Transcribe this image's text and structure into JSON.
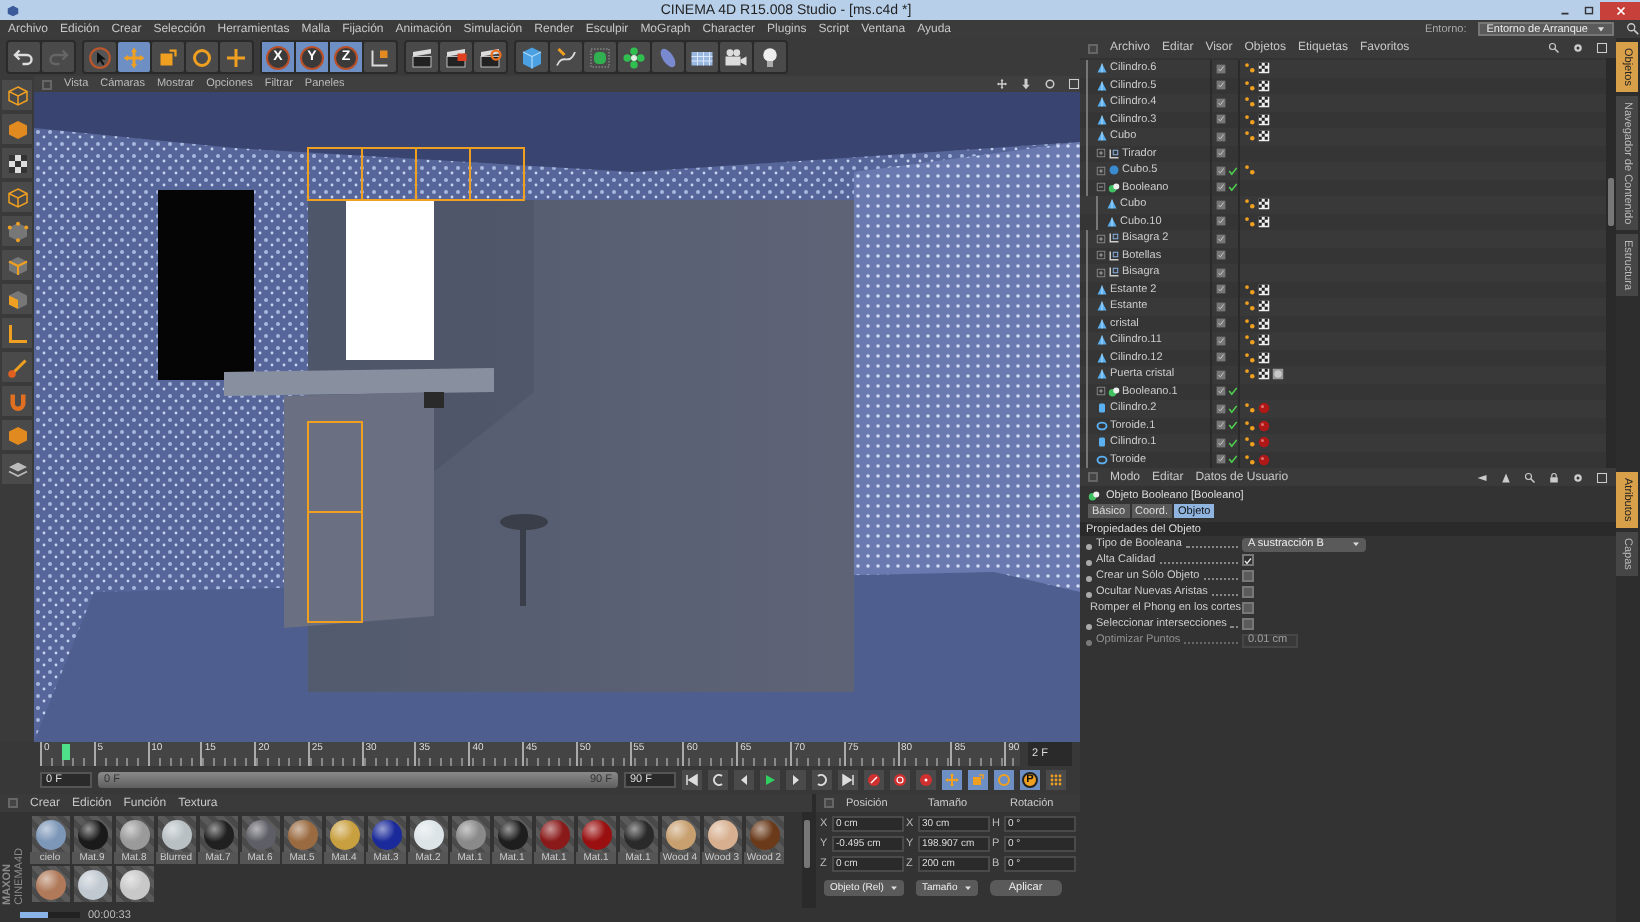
{
  "window": {
    "title": "CINEMA 4D R15.008 Studio - [ms.c4d *]"
  },
  "menu": [
    "Archivo",
    "Edición",
    "Crear",
    "Selección",
    "Herramientas",
    "Malla",
    "Fijación",
    "Animación",
    "Simulación",
    "Render",
    "Esculpir",
    "MoGraph",
    "Character",
    "Plugins",
    "Script",
    "Ventana",
    "Ayuda"
  ],
  "layout_switch": {
    "label": "Entorno:",
    "value": "Entorno de Arranque"
  },
  "toolbar": {
    "axis_buttons": [
      "X",
      "Y",
      "Z"
    ]
  },
  "viewport": {
    "menu": [
      "Vista",
      "Cámaras",
      "Mostrar",
      "Opciones",
      "Filtrar",
      "Paneles"
    ]
  },
  "timeline": {
    "ticks": [
      "0",
      "5",
      "10",
      "15",
      "20",
      "25",
      "30",
      "35",
      "40",
      "45",
      "50",
      "55",
      "60",
      "65",
      "70",
      "75",
      "80",
      "85",
      "90"
    ],
    "playhead": {
      "level": 0.022
    },
    "range": {
      "level": 1
    },
    "current_frame": "2 F",
    "start_field": "0 F",
    "range_start": "0 F",
    "range_end": "90 F",
    "end_field": "90 F",
    "param_key": "P"
  },
  "materials": {
    "menu": [
      "Crear",
      "Edición",
      "Función",
      "Textura"
    ],
    "logo": [
      "MAXON",
      "CINEMA4D"
    ],
    "items": [
      {
        "name": "cielo",
        "color": "#7d97b8"
      },
      {
        "name": "Mat.9",
        "color": "#1a1a1a"
      },
      {
        "name": "Mat.8",
        "color": "#9a9a9a"
      },
      {
        "name": "Blurred",
        "color": "#b8c0c4"
      },
      {
        "name": "Mat.7",
        "color": "#202020"
      },
      {
        "name": "Mat.6",
        "color": "#5e5e66"
      },
      {
        "name": "Mat.5",
        "color": "#9a6a40"
      },
      {
        "name": "Mat.4",
        "color": "#c9a040"
      },
      {
        "name": "Mat.3",
        "color": "#1a2a9a"
      },
      {
        "name": "Mat.2",
        "color": "#dde4e8"
      },
      {
        "name": "Mat.1",
        "color": "#8a8a8a"
      },
      {
        "name": "Mat.1",
        "color": "#1e1e1e"
      },
      {
        "name": "Mat.1",
        "color": "#8a1a1a"
      },
      {
        "name": "Mat.1",
        "color": "#9a1010"
      },
      {
        "name": "Mat.1",
        "color": "#2a2a2a"
      },
      {
        "name": "Wood 4",
        "color": "#c8a070"
      },
      {
        "name": "Wood 3",
        "color": "#d8b090"
      },
      {
        "name": "Wood 2",
        "color": "#6a3a1a"
      },
      {
        "color": "#b07a5a"
      },
      {
        "color": "#c0c8d0"
      },
      {
        "color": "#c8c8c8"
      }
    ]
  },
  "coordinates": {
    "headers": [
      "Posición",
      "Tamaño",
      "Rotación"
    ],
    "rows": [
      {
        "axis": "X",
        "position": "0 cm",
        "size_axis": "X",
        "size": "30 cm",
        "rotation_axis": "H",
        "rotation": "0 °"
      },
      {
        "axis": "Y",
        "position": "-0.495 cm",
        "size_axis": "Y",
        "size": "198.907 cm",
        "rotation_axis": "P",
        "rotation": "0 °"
      },
      {
        "axis": "Z",
        "position": "0 cm",
        "size_axis": "Z",
        "size": "200 cm",
        "rotation_axis": "B",
        "rotation": "0 °"
      }
    ],
    "mode": "Objeto (Rel)",
    "size_mode": "Tamaño",
    "apply": "Aplicar"
  },
  "status_bar": {
    "progress": {
      "level": 0.45
    },
    "time": "00:00:33"
  },
  "object_manager": {
    "menu": [
      "Archivo",
      "Editar",
      "Visor",
      "Objetos",
      "Etiquetas",
      "Favoritos"
    ],
    "rows": [
      {
        "name": "Cilindro.6",
        "kind": "polygon",
        "generator_on": false,
        "tags": [
          {
            "kind": "phong"
          },
          {
            "kind": "uvw"
          }
        ]
      },
      {
        "name": "Cilindro.5",
        "kind": "polygon",
        "generator_on": false,
        "tags": [
          {
            "kind": "phong"
          },
          {
            "kind": "uvw"
          }
        ]
      },
      {
        "name": "Cilindro.4",
        "kind": "polygon",
        "generator_on": false,
        "tags": [
          {
            "kind": "phong"
          },
          {
            "kind": "uvw"
          }
        ]
      },
      {
        "name": "Cilindro.3",
        "kind": "polygon",
        "generator_on": false,
        "tags": [
          {
            "kind": "phong"
          },
          {
            "kind": "uvw"
          }
        ]
      },
      {
        "name": "Cubo",
        "kind": "polygon",
        "generator_on": false,
        "tags": [
          {
            "kind": "phong"
          },
          {
            "kind": "uvw"
          }
        ]
      },
      {
        "name": "Tirador",
        "kind": "null",
        "generator_on": false,
        "tags": []
      },
      {
        "name": "Cubo.5",
        "kind": "generator",
        "generator_on": true,
        "tags": [
          {
            "kind": "phong"
          }
        ]
      },
      {
        "name": "Booleano",
        "kind": "boolean",
        "generator_on": true,
        "tags": [],
        "children": [
          {
            "name": "Cubo",
            "kind": "polygon",
            "generator_on": false,
            "tags": [
              {
                "kind": "phong"
              },
              {
                "kind": "uvw"
              }
            ]
          },
          {
            "name": "Cubo.10",
            "kind": "polygon",
            "generator_on": false,
            "tags": [
              {
                "kind": "phong"
              },
              {
                "kind": "uvw"
              }
            ]
          }
        ]
      },
      {
        "name": "Bisagra 2",
        "kind": "null",
        "generator_on": false,
        "tags": []
      },
      {
        "name": "Botellas",
        "kind": "null",
        "generator_on": false,
        "tags": []
      },
      {
        "name": "Bisagra",
        "kind": "null",
        "generator_on": false,
        "tags": []
      },
      {
        "name": "Estante 2",
        "kind": "polygon",
        "generator_on": false,
        "tags": [
          {
            "kind": "phong"
          },
          {
            "kind": "uvw"
          }
        ]
      },
      {
        "name": "Estante",
        "kind": "polygon",
        "generator_on": false,
        "tags": [
          {
            "kind": "phong"
          },
          {
            "kind": "uvw"
          }
        ]
      },
      {
        "name": "cristal",
        "kind": "polygon",
        "generator_on": false,
        "tags": [
          {
            "kind": "phong"
          },
          {
            "kind": "uvw"
          }
        ]
      },
      {
        "name": "Cilindro.11",
        "kind": "polygon",
        "generator_on": false,
        "tags": [
          {
            "kind": "phong"
          },
          {
            "kind": "uvw"
          }
        ]
      },
      {
        "name": "Cilindro.12",
        "kind": "polygon",
        "generator_on": false,
        "tags": [
          {
            "kind": "phong"
          },
          {
            "kind": "uvw"
          }
        ]
      },
      {
        "name": "Puerta cristal",
        "kind": "polygon",
        "generator_on": false,
        "tags": [
          {
            "kind": "phong"
          },
          {
            "kind": "uvw"
          },
          {
            "kind": "glass"
          }
        ]
      },
      {
        "name": "Booleano.1",
        "kind": "boolean",
        "generator_on": true,
        "tags": []
      },
      {
        "name": "Cilindro.2",
        "kind": "cylinder",
        "generator_on": true,
        "tags": [
          {
            "kind": "phong"
          },
          {
            "kind": "material"
          }
        ]
      },
      {
        "name": "Toroide.1",
        "kind": "torus",
        "generator_on": true,
        "tags": [
          {
            "kind": "phong"
          },
          {
            "kind": "material"
          }
        ]
      },
      {
        "name": "Cilindro.1",
        "kind": "cylinder",
        "generator_on": true,
        "tags": [
          {
            "kind": "phong"
          },
          {
            "kind": "material"
          }
        ]
      },
      {
        "name": "Toroide",
        "kind": "torus",
        "generator_on": true,
        "tags": [
          {
            "kind": "phong"
          },
          {
            "kind": "material"
          }
        ]
      }
    ]
  },
  "side_tabs_top": [
    {
      "label": "Objetos",
      "selected": true
    },
    {
      "label": "Navegador de Contenido",
      "selected": false
    },
    {
      "label": "Estructura",
      "selected": false
    }
  ],
  "attributes": {
    "menu": [
      "Modo",
      "Editar",
      "Datos de Usuario"
    ],
    "title": "Objeto Booleano [Booleano]",
    "tabs": [
      {
        "label": "Básico",
        "selected": false
      },
      {
        "label": "Coord.",
        "selected": false
      },
      {
        "label": "Objeto",
        "selected": true
      }
    ],
    "section": "Propiedades del Objeto",
    "properties": [
      {
        "label": "Tipo de Booleana",
        "kind": "dropdown",
        "value": "A sustracción B",
        "disabled": false
      },
      {
        "label": "Alta Calidad",
        "kind": "checkbox",
        "checked": true,
        "disabled": false
      },
      {
        "label": "Crear un Sólo Objeto",
        "kind": "checkbox",
        "checked": false,
        "disabled": false
      },
      {
        "label": "Ocultar Nuevas Aristas",
        "kind": "checkbox",
        "checked": false,
        "disabled": false
      },
      {
        "label": "Romper el Phong en los cortes",
        "kind": "checkbox",
        "checked": false,
        "disabled": false
      },
      {
        "label": "Seleccionar intersecciones",
        "kind": "checkbox",
        "checked": false,
        "disabled": false
      },
      {
        "label": "Optimizar Puntos",
        "kind": "number",
        "value": "0.01 cm",
        "disabled": true
      }
    ]
  },
  "side_tabs_bottom": [
    {
      "label": "Atributos",
      "selected": true
    },
    {
      "label": "Capas",
      "selected": false
    }
  ]
}
